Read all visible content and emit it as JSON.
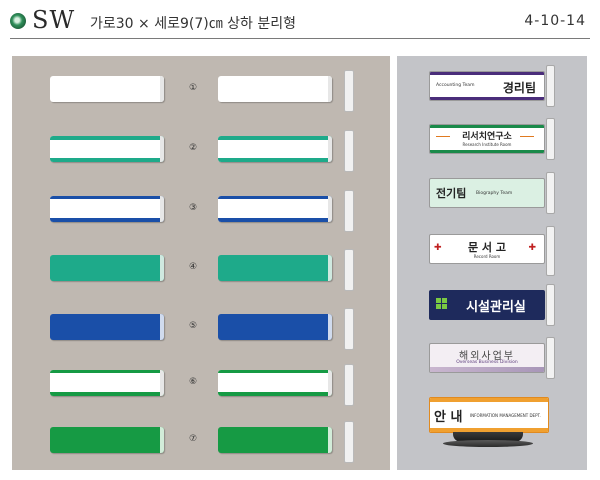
{
  "header": {
    "series": "SW",
    "description": "가로30 × 세로9(7)㎝ 상하 분리형",
    "code": "4-10-14"
  },
  "colors": {
    "green": "#1a9e6a",
    "teal": "#1eaa8a",
    "blue": "#1a4fa8",
    "dark_green": "#169a44",
    "panel_left": "#bfb8b1",
    "panel_right": "#c3c4c8"
  },
  "variants": [
    {
      "number": "①",
      "style": "white plain",
      "top_band": "none",
      "bottom_band": "none"
    },
    {
      "number": "②",
      "style": "white with green edges",
      "top_band": "green",
      "bottom_band": "green"
    },
    {
      "number": "③",
      "style": "white with blue edges",
      "top_band": "blue",
      "bottom_band": "blue"
    },
    {
      "number": "④",
      "style": "solid teal",
      "fill": "teal"
    },
    {
      "number": "⑤",
      "style": "solid blue",
      "fill": "blue"
    },
    {
      "number": "⑥",
      "style": "white with green edges",
      "top_band": "dark_green",
      "bottom_band": "dark_green"
    },
    {
      "number": "⑦",
      "style": "solid green",
      "fill": "dark_green"
    }
  ],
  "examples": [
    {
      "name": "경리팀",
      "sub": "Accounting Team"
    },
    {
      "name": "리서치연구소",
      "sub": "Research Institute Room"
    },
    {
      "name": "전기팀",
      "sub": "Biography Team"
    },
    {
      "name": "문 서 고",
      "sub": "Record Room"
    },
    {
      "name": "시설관리실",
      "sub": ""
    },
    {
      "name": "해외사업부",
      "sub": "Overseas Business Division"
    },
    {
      "name": "안 내",
      "sub": "INFORMATION MANAGEMENT DEPT."
    }
  ]
}
